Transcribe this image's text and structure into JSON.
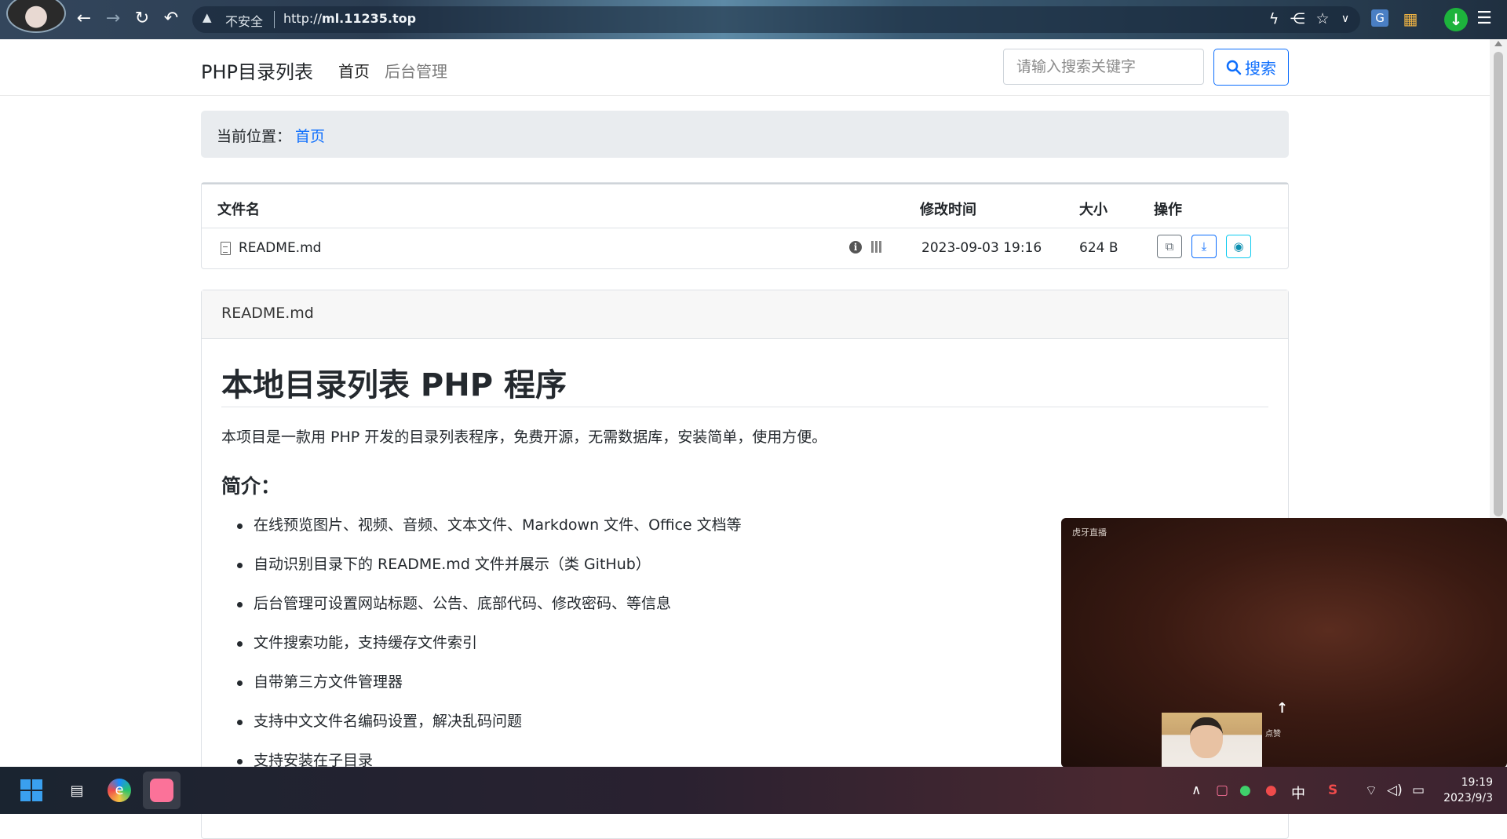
{
  "browser": {
    "insecure_label": "不安全",
    "url_prefix": "http://",
    "url_host": "ml.11235.top"
  },
  "navbar": {
    "brand": "PHP目录列表",
    "home": "首页",
    "admin": "后台管理",
    "search_placeholder": "请输入搜索关键字",
    "search_button": "搜索"
  },
  "breadcrumb": {
    "label": "当前位置：",
    "home": "首页"
  },
  "table": {
    "headers": {
      "name": "文件名",
      "mtime": "修改时间",
      "size": "大小",
      "actions": "操作"
    },
    "rows": [
      {
        "name": "README.md",
        "mtime": "2023-09-03 19:16",
        "size": "624 B"
      }
    ]
  },
  "readme": {
    "title": "README.md",
    "h1": "本地目录列表 PHP 程序",
    "intro": "本项目是一款用 PHP 开发的目录列表程序，免费开源，无需数据库，安装简单，使用方便。",
    "h2": "简介：",
    "items": [
      "在线预览图片、视频、音频、文本文件、Markdown 文件、Office 文档等",
      "自动识别目录下的 README.md 文件并展示（类 GitHub）",
      "后台管理可设置网站标题、公告、底部代码、修改密码、等信息",
      "文件搜索功能，支持缓存文件索引",
      "自带第三方文件管理器",
      "支持中文文件名编码设置，解决乱码问题",
      "支持安装在子目录"
    ]
  },
  "video_overlay": {
    "logo": "虎牙直播",
    "tag": "点赞"
  },
  "taskbar": {
    "ime": "中",
    "time": "19:19",
    "date": "2023/9/3"
  },
  "colors": {
    "primary": "#0d6efd",
    "success": "#1db33c",
    "breadcrumb_bg": "#e9ecef"
  }
}
